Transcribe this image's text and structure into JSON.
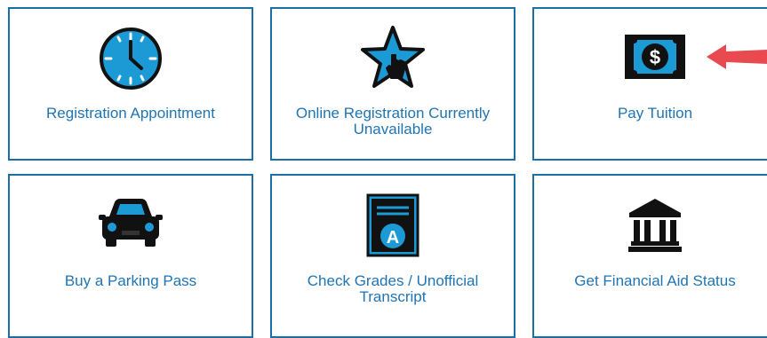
{
  "tiles": [
    {
      "label": "Registration Appointment",
      "icon": "clock-icon"
    },
    {
      "label": "Online Registration Currently Unavailable",
      "icon": "star-pointer-icon"
    },
    {
      "label": "Pay Tuition",
      "icon": "dollar-bill-icon"
    },
    {
      "label": "Buy a Parking Pass",
      "icon": "car-icon"
    },
    {
      "label": "Check Grades / Unofficial Transcript",
      "icon": "transcript-icon"
    },
    {
      "label": "Get Financial Aid Status",
      "icon": "bank-icon"
    }
  ],
  "colors": {
    "border": "#1b6fa8",
    "label": "#1f74b3",
    "icon_blue": "#1b9ad6",
    "icon_dark": "#111111",
    "annotation_arrow": "#e84a4f"
  }
}
